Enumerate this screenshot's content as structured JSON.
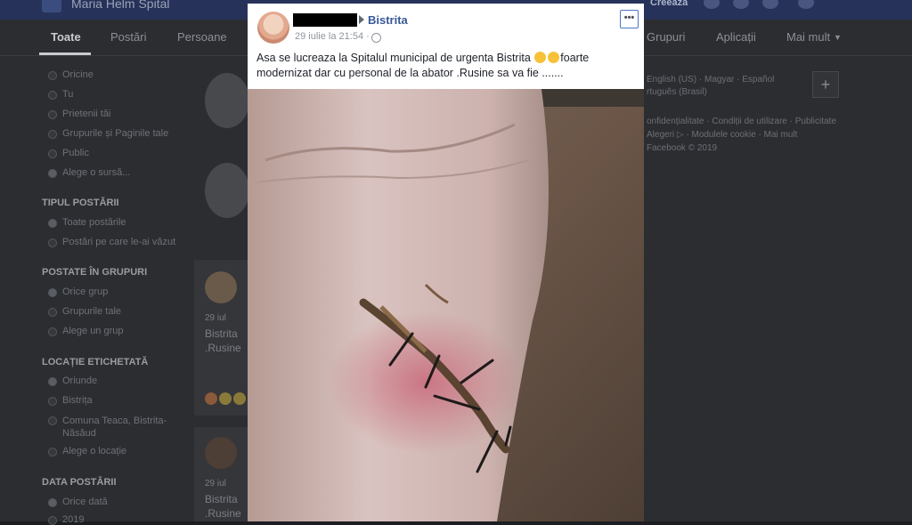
{
  "topbar": {
    "search_value": "Maria Helm Spital",
    "create_label": "Creează"
  },
  "tabs": [
    "Toate",
    "Postări",
    "Persoane",
    "Grupuri",
    "Aplicații",
    "Mai mult"
  ],
  "filters": {
    "sections": [
      {
        "title": "",
        "options": [
          "Oricine",
          "Tu",
          "Prietenii tăi",
          "Grupurile și Paginile tale",
          "Public",
          "Alege o sursă..."
        ]
      },
      {
        "title": "TIPUL POSTĂRII",
        "options": [
          "Toate postările",
          "Postări pe care le-ai văzut"
        ]
      },
      {
        "title": "POSTATE ÎN GRUPURI",
        "options": [
          "Orice grup",
          "Grupurile tale",
          "Alege un grup"
        ]
      },
      {
        "title": "LOCAȚIE ETICHETATĂ",
        "options": [
          "Oriunde",
          "Bistrița",
          "Comuna Teaca, Bistrita-Năsăud",
          "Alege o locație"
        ]
      },
      {
        "title": "DATA POSTĂRII",
        "options": [
          "Orice dată",
          "2019"
        ]
      }
    ]
  },
  "bg_cards": [
    {
      "date": "29 iul",
      "text1": "Bistrita",
      "text2": ".Rusine"
    },
    {
      "date": "29 iul",
      "text1": "Bistrita",
      "text2": ".Rusine"
    }
  ],
  "right_col": {
    "languages": "English (US) · Magyar · Español",
    "lang2": "rtuguês (Brasil)",
    "links": "onfidențialitate · Condiții de utilizare · Publicitate",
    "links2": "Alegeri ▷ · Modulele cookie · Mai mult",
    "copyright": "Facebook © 2019"
  },
  "post": {
    "page_name": "Bistrita",
    "timestamp": "29 iulie la 21:54 ·",
    "text_part1": "Asa se lucreaza la Spitalul municipal de urgenta Bistrita",
    "text_part2": "foarte modernizat dar cu personal de la abator .Rusine sa va fie .......",
    "more_label": "•••"
  },
  "colors": {
    "link": "#385898",
    "topbar": "#27325a"
  }
}
